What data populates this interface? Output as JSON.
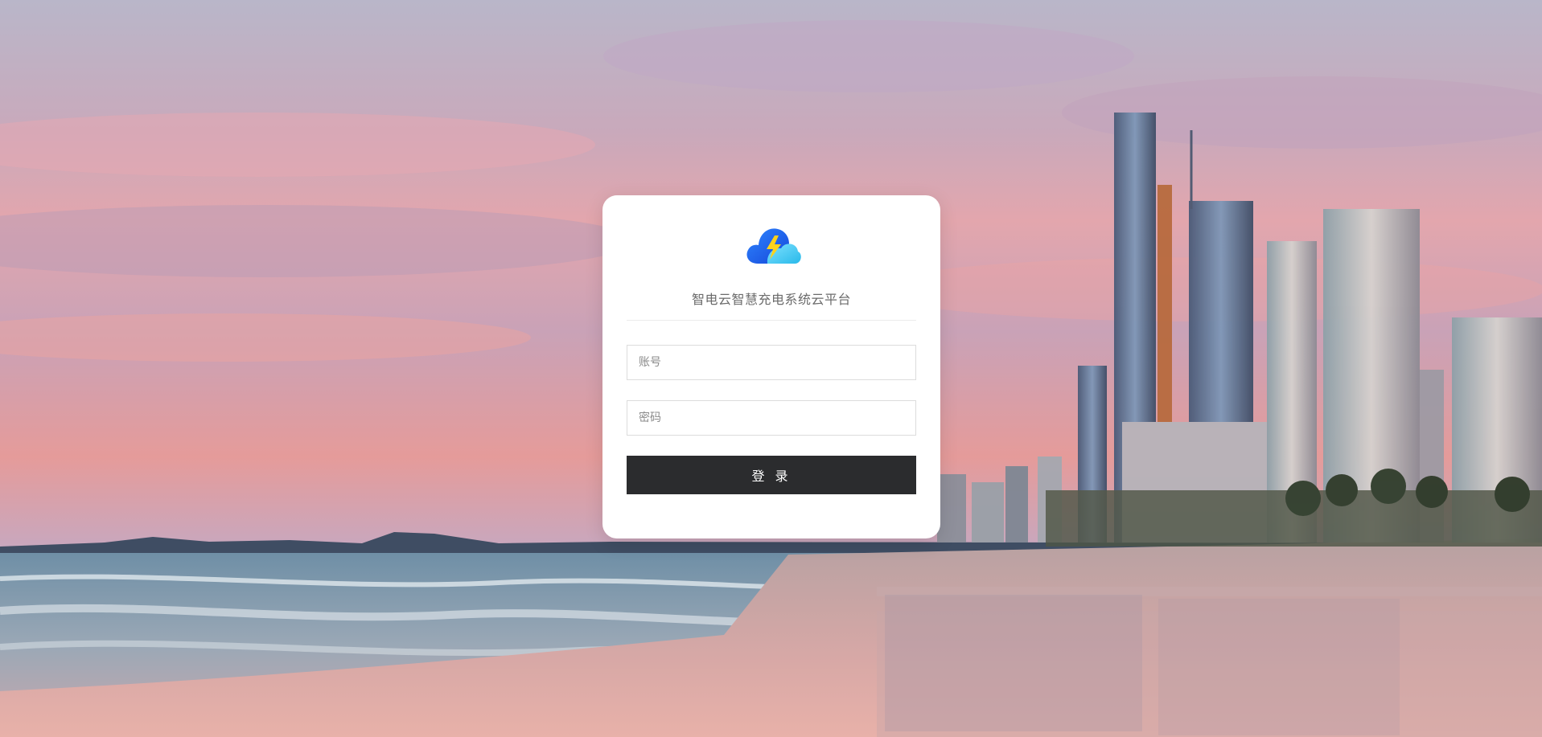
{
  "login": {
    "title": "智电云智慧充电系统云平台",
    "account_placeholder": "账号",
    "password_placeholder": "密码",
    "submit_label": "登 录"
  },
  "colors": {
    "button_bg": "#2b2c2e",
    "card_bg": "#ffffff",
    "logo_blue": "#1a5cf0",
    "logo_cyan": "#3fc8f0",
    "logo_bolt": "#ffd21a"
  },
  "icons": {
    "logo": "cloud-lightning-icon"
  }
}
